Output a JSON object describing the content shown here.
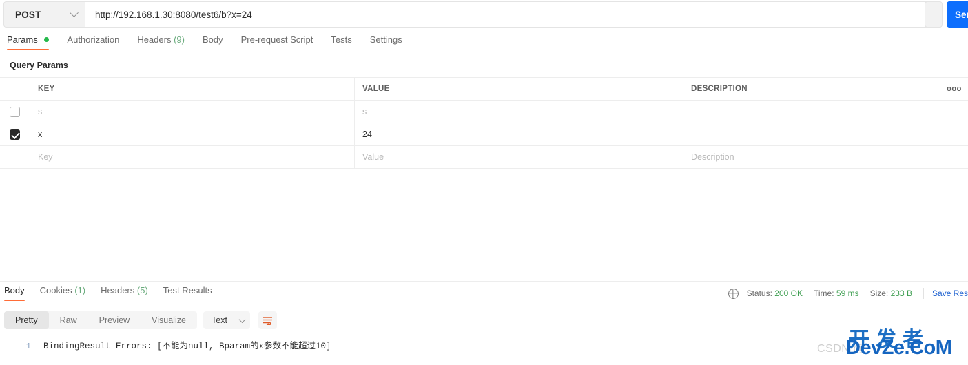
{
  "request": {
    "method": "POST",
    "url": "http://192.168.1.30:8080/test6/b?x=24",
    "send_label": "Sen",
    "tabs": [
      {
        "label": "Params",
        "badge": "dot",
        "active": true
      },
      {
        "label": "Authorization",
        "badge": "",
        "active": false
      },
      {
        "label": "Headers",
        "count": "(9)",
        "active": false
      },
      {
        "label": "Body",
        "badge": "",
        "active": false
      },
      {
        "label": "Pre-request Script",
        "badge": "",
        "active": false
      },
      {
        "label": "Tests",
        "badge": "",
        "active": false
      },
      {
        "label": "Settings",
        "badge": "",
        "active": false
      }
    ],
    "section_title": "Query Params",
    "table": {
      "headers": {
        "key": "KEY",
        "value": "VALUE",
        "description": "DESCRIPTION",
        "more": "ooo"
      },
      "rows": [
        {
          "checked": false,
          "key": "s",
          "value": "s",
          "description": "",
          "placeholder_style": true
        },
        {
          "checked": true,
          "key": "x",
          "value": "24",
          "description": "",
          "placeholder_style": false
        },
        {
          "checked": null,
          "key": "Key",
          "value": "Value",
          "description": "Description",
          "placeholder_style": true
        }
      ]
    }
  },
  "response": {
    "tabs": [
      {
        "label": "Body",
        "count": "",
        "active": true
      },
      {
        "label": "Cookies",
        "count": "(1)",
        "active": false
      },
      {
        "label": "Headers",
        "count": "(5)",
        "active": false
      },
      {
        "label": "Test Results",
        "count": "",
        "active": false
      }
    ],
    "status": {
      "status_label": "Status:",
      "status_value": "200 OK",
      "time_label": "Time:",
      "time_value": "59 ms",
      "size_label": "Size:",
      "size_value": "233 B",
      "save_label": "Save Res"
    },
    "format_tabs": [
      {
        "label": "Pretty",
        "active": true
      },
      {
        "label": "Raw",
        "active": false
      },
      {
        "label": "Preview",
        "active": false
      },
      {
        "label": "Visualize",
        "active": false
      }
    ],
    "type_selected": "Text",
    "body": {
      "line_number": "1",
      "text": "BindingResult Errors: [不能为null, Bparam的x参数不能超过10]"
    }
  },
  "watermark": {
    "csdn": "CSDN @",
    "chinese": "开发者",
    "english": "DevZe.CoM"
  },
  "colors": {
    "accent_orange": "#ff6c37",
    "send_blue": "#0d6efd",
    "status_green": "#3f9f52",
    "dot_green": "#25b94b",
    "link_blue": "#2264d1"
  }
}
